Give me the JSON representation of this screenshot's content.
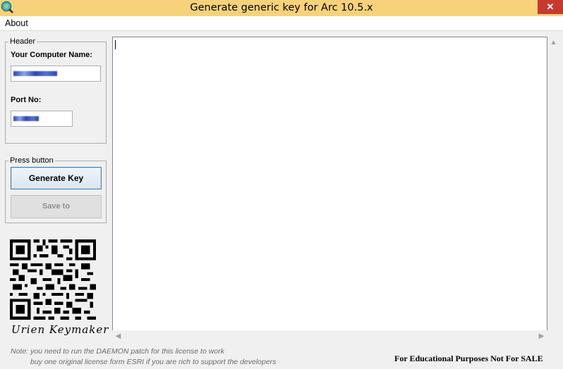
{
  "window": {
    "title": "Generate generic key for Arc 10.5.x",
    "close_glyph": "✕"
  },
  "menu": {
    "about": "About"
  },
  "header_group": {
    "legend": "Header",
    "computer_name_label": "Your Computer Name:",
    "computer_name_value": "",
    "port_label": "Port No:",
    "port_value": ""
  },
  "press_group": {
    "legend": "Press button",
    "generate_label": "Generate Key",
    "save_label": "Save to"
  },
  "output": {
    "text": ""
  },
  "signature": "Urien Keymaker",
  "notes": {
    "line1": "Note: you need to run the DAEMON patch for this license to work",
    "line2": "buy one original license form ESRI if you are rich to support the developers",
    "educational": "For Educational Purposes Not For SALE"
  },
  "colors": {
    "titlebar": "#f8d27a",
    "close": "#c7392f",
    "accent": "#3c7fb1"
  },
  "icons": {
    "app": "globe-magnifier-icon",
    "close": "close-icon",
    "qr": "qr-code-icon"
  }
}
